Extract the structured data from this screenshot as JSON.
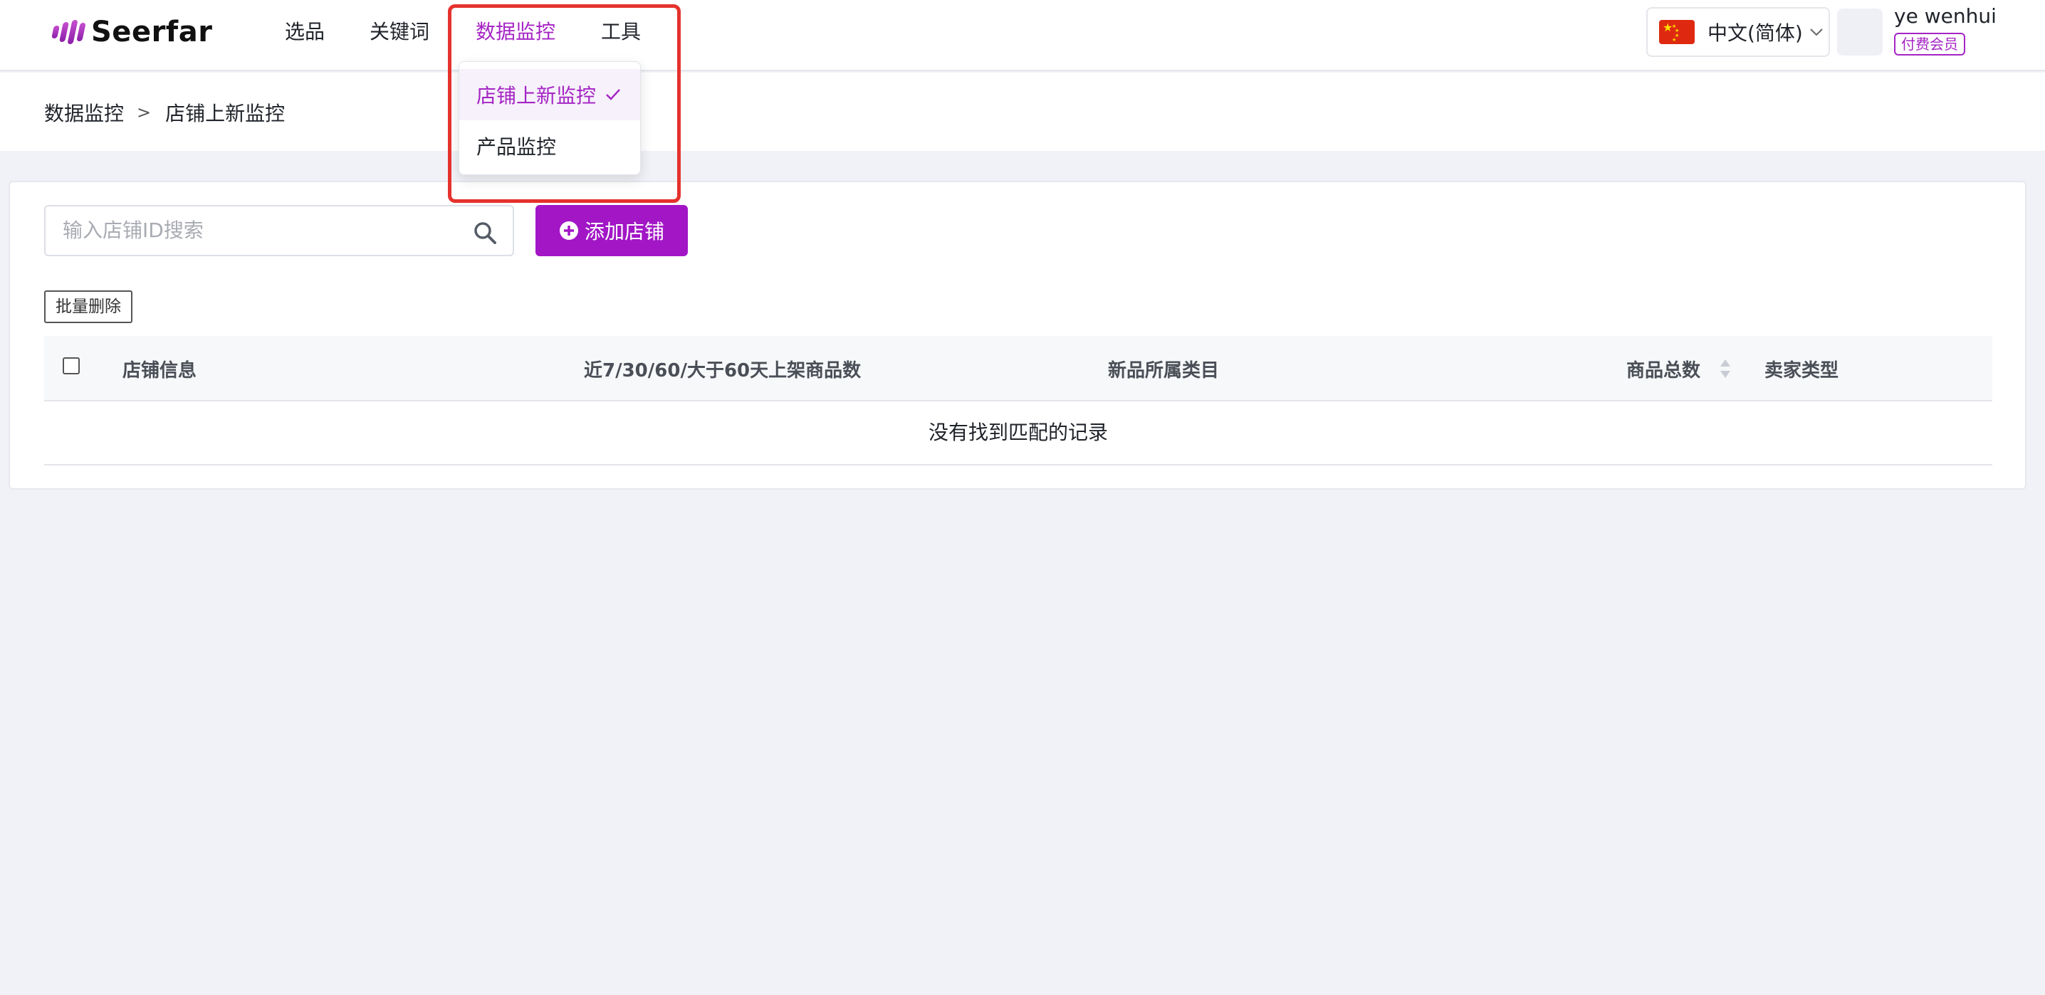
{
  "brand": {
    "name": "Seerfar"
  },
  "nav": {
    "items": [
      {
        "label": "选品"
      },
      {
        "label": "关键词"
      },
      {
        "label": "数据监控"
      },
      {
        "label": "工具"
      }
    ],
    "dropdown": [
      {
        "label": "店铺上新监控",
        "selected": true
      },
      {
        "label": "产品监控",
        "selected": false
      }
    ]
  },
  "language": {
    "label": "中文(简体)"
  },
  "user": {
    "name": "ye wenhui",
    "badge": "付费会员"
  },
  "breadcrumb": {
    "parent": "数据监控",
    "separator": ">",
    "current": "店铺上新监控"
  },
  "search": {
    "placeholder": "输入店铺ID搜索",
    "value": ""
  },
  "toolbar": {
    "add_label": "添加店铺",
    "bulk_delete_label": "批量删除"
  },
  "table": {
    "columns": [
      "店铺信息",
      "近7/30/60/大于60天上架商品数",
      "新品所属类目",
      "商品总数",
      "卖家类型"
    ],
    "empty_text": "没有找到匹配的记录"
  },
  "colors": {
    "accent": "#a216c6",
    "highlight": "#e5322d"
  }
}
